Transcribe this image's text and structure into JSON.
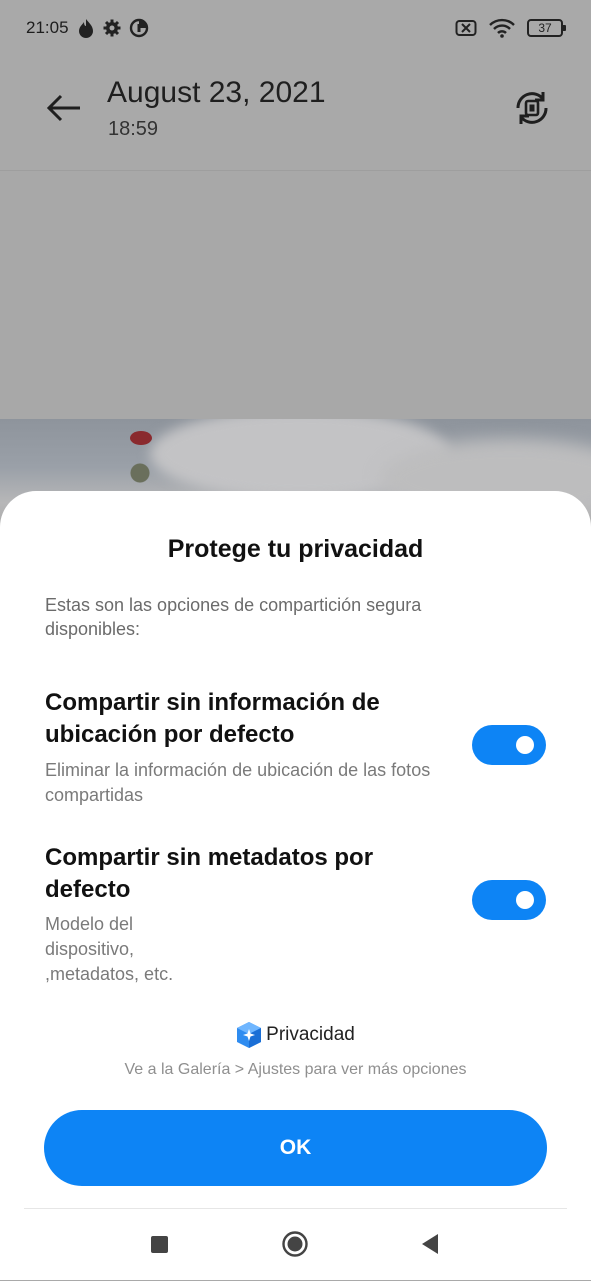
{
  "status_bar": {
    "time": "21:05",
    "battery": "37"
  },
  "app_bar": {
    "date": "August 23, 2021",
    "time": "18:59"
  },
  "sheet": {
    "title": "Protege tu privacidad",
    "description": "Estas son las opciones de compartición segura disponibles:",
    "options": [
      {
        "title": "Compartir sin información de ubicación por defecto",
        "description": "Eliminar la información de ubicación de las fotos compartidas",
        "enabled": true
      },
      {
        "title": "Compartir sin metadatos por defecto",
        "description": "Modelo del dispositivo, ,metadatos, etc.",
        "enabled": true
      }
    ],
    "privacy_label": "Privacidad",
    "hint": "Ve a la Galería > Ajustes para ver más opciones",
    "ok_label": "OK"
  },
  "colors": {
    "accent": "#0d84f5",
    "scrim": "#a9a9a9"
  }
}
